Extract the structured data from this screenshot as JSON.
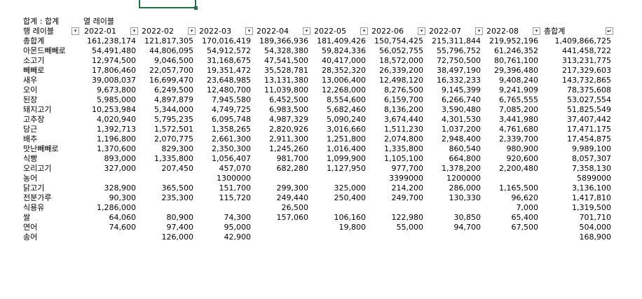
{
  "pivot": {
    "filter_label": "합계 : 합계",
    "col_labels_title": "열 레이블",
    "row_labels_title": "행 레이블",
    "grand_total_header": "총합계",
    "columns": [
      "2022-01",
      "2022-02",
      "2022-03",
      "2022-04",
      "2022-05",
      "2022-06",
      "2022-07",
      "2022-08"
    ],
    "rows": [
      {
        "label": "총합계",
        "values": [
          "161,238,174",
          "121,817,305",
          "170,016,419",
          "189,366,936",
          "181,409,426",
          "150,754,425",
          "215,311,844",
          "219,952,196"
        ],
        "total": "1,409,866,725"
      },
      {
        "label": "아몬드빼빼로",
        "values": [
          "54,491,480",
          "44,806,095",
          "54,912,572",
          "54,328,380",
          "59,824,336",
          "56,052,755",
          "55,796,752",
          "61,246,352"
        ],
        "total": "441,458,722"
      },
      {
        "label": "소고기",
        "values": [
          "12,974,500",
          "9,046,500",
          "31,168,675",
          "47,541,500",
          "40,417,000",
          "18,572,000",
          "72,750,500",
          "80,761,100"
        ],
        "total": "313,231,775"
      },
      {
        "label": "빼빼로",
        "values": [
          "17,806,460",
          "22,057,700",
          "19,351,472",
          "35,528,781",
          "28,352,320",
          "26,339,200",
          "38,497,190",
          "29,396,480"
        ],
        "total": "217,329,603"
      },
      {
        "label": "새우",
        "values": [
          "39,008,037",
          "16,699,470",
          "23,648,985",
          "13,131,380",
          "13,006,400",
          "12,498,120",
          "16,332,233",
          "9,408,240"
        ],
        "total": "143,732,865"
      },
      {
        "label": "오이",
        "values": [
          "9,673,800",
          "6,249,500",
          "12,480,700",
          "11,039,800",
          "12,268,000",
          "8,276,500",
          "9,145,399",
          "9,241,909"
        ],
        "total": "78,375,608"
      },
      {
        "label": "된장",
        "values": [
          "5,985,000",
          "4,897,879",
          "7,945,580",
          "6,452,500",
          "8,554,600",
          "6,159,700",
          "6,266,740",
          "6,765,555"
        ],
        "total": "53,027,554"
      },
      {
        "label": "돼지고기",
        "values": [
          "10,253,984",
          "5,344,000",
          "4,749,725",
          "6,983,500",
          "5,682,460",
          "8,136,200",
          "3,590,480",
          "7,085,200"
        ],
        "total": "51,825,549"
      },
      {
        "label": "고추장",
        "values": [
          "4,020,940",
          "5,795,235",
          "6,095,748",
          "4,987,329",
          "5,090,240",
          "3,674,440",
          "4,301,530",
          "3,441,980"
        ],
        "total": "37,407,442"
      },
      {
        "label": "당근",
        "values": [
          "1,392,713",
          "1,572,501",
          "1,358,265",
          "2,820,926",
          "3,016,660",
          "1,511,230",
          "1,037,200",
          "4,761,680"
        ],
        "total": "17,471,175"
      },
      {
        "label": "배추",
        "values": [
          "1,196,800",
          "2,070,775",
          "2,661,300",
          "2,911,300",
          "1,251,800",
          "2,074,800",
          "2,948,400",
          "2,339,700"
        ],
        "total": "17,454,875"
      },
      {
        "label": "맛난빼빼로",
        "values": [
          "1,370,600",
          "829,300",
          "2,350,300",
          "1,245,260",
          "1,016,400",
          "1,335,800",
          "860,540",
          "980,900"
        ],
        "total": "9,989,100"
      },
      {
        "label": "식빵",
        "values": [
          "893,000",
          "1,335,800",
          "1,056,407",
          "981,700",
          "1,099,900",
          "1,105,100",
          "664,800",
          "920,600"
        ],
        "total": "8,057,307"
      },
      {
        "label": "오리고기",
        "values": [
          "327,000",
          "207,450",
          "457,070",
          "682,280",
          "1,127,950",
          "977,700",
          "1,378,200",
          "2,200,480"
        ],
        "total": "7,358,130"
      },
      {
        "label": "농어",
        "values": [
          "",
          "",
          "1300000",
          "",
          "",
          "3399000",
          "1200000",
          ""
        ],
        "total": "5899000"
      },
      {
        "label": "닭고기",
        "values": [
          "328,900",
          "365,500",
          "151,700",
          "299,300",
          "325,000",
          "214,200",
          "286,000",
          "1,165,500"
        ],
        "total": "3,136,100"
      },
      {
        "label": "전분가루",
        "values": [
          "90,300",
          "235,300",
          "115,720",
          "249,440",
          "250,400",
          "249,700",
          "130,330",
          "96,620"
        ],
        "total": "1,417,810"
      },
      {
        "label": "식용유",
        "values": [
          "1,286,000",
          "",
          "",
          "26,500",
          "",
          "",
          "",
          "7,000"
        ],
        "total": "1,319,500"
      },
      {
        "label": "쌀",
        "values": [
          "64,060",
          "80,900",
          "74,300",
          "157,060",
          "106,160",
          "122,980",
          "30,850",
          "65,400"
        ],
        "total": "701,710"
      },
      {
        "label": "연어",
        "values": [
          "74,600",
          "97,400",
          "95,000",
          "",
          "19,800",
          "55,000",
          "94,700",
          "67,500"
        ],
        "total": "504,000"
      },
      {
        "label": "송어",
        "values": [
          "",
          "126,000",
          "42,900",
          "",
          "",
          "",
          "",
          ""
        ],
        "total": "168,900"
      }
    ]
  }
}
